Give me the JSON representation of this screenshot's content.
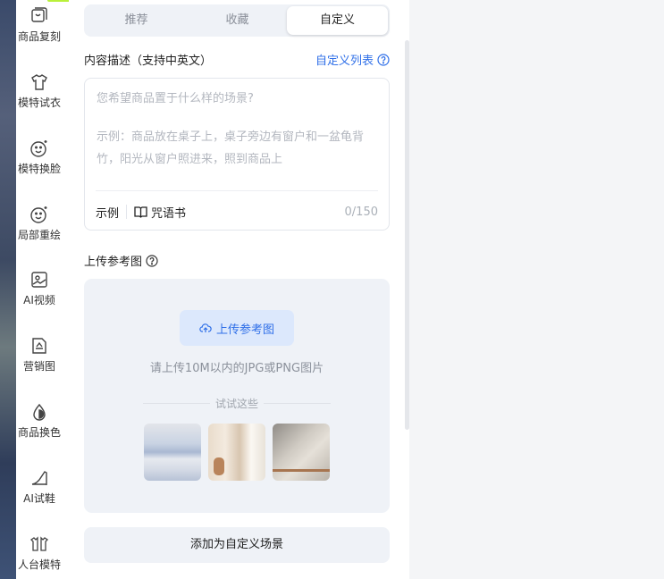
{
  "sidebar": {
    "items": [
      {
        "label": "商品复刻",
        "icon": "copy-box-icon"
      },
      {
        "label": "模特试衣",
        "icon": "tshirt-icon"
      },
      {
        "label": "模特换脸",
        "icon": "face-icon"
      },
      {
        "label": "局部重绘",
        "icon": "face-sparkle-icon"
      },
      {
        "label": "AI视频",
        "icon": "video-image-icon"
      },
      {
        "label": "营销图",
        "icon": "poster-icon"
      },
      {
        "label": "商品换色",
        "icon": "color-drop-icon"
      },
      {
        "label": "AI试鞋",
        "icon": "high-heel-icon"
      },
      {
        "label": "人台模特",
        "icon": "mannequin-icon"
      }
    ]
  },
  "tabs": [
    {
      "label": "推荐"
    },
    {
      "label": "收藏"
    },
    {
      "label": "自定义",
      "active": true
    }
  ],
  "description": {
    "label": "内容描述（支持中英文）",
    "list_link": "自定义列表",
    "placeholder_line1": "您希望商品置于什么样的场景?",
    "placeholder_line2": "示例：商品放在桌子上，桌子旁边有窗户和一盆龟背竹，阳光从窗户照进来，照到商品上",
    "example_label": "示例",
    "spellbook_label": "咒语书",
    "count": "0/150"
  },
  "upload": {
    "label": "上传参考图",
    "button": "上传参考图",
    "hint": "请上传10M以内的JPG或PNG图片",
    "try_label": "试试这些"
  },
  "add_button": "添加为自定义场景",
  "colors": {
    "accent": "#2f6fe8",
    "panel": "#eff2f7"
  }
}
